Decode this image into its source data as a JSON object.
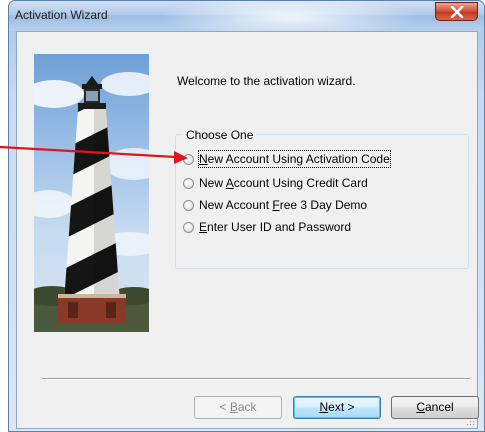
{
  "window": {
    "title": "Activation Wizard"
  },
  "main": {
    "welcome_text": "Welcome to the activation wizard.",
    "group_label": "Choose One",
    "options": [
      {
        "label": "New Account Using Activation Code",
        "mnemonic": "N",
        "selected": false,
        "focused": true
      },
      {
        "label": "New Account Using Credit Card",
        "mnemonic": "A",
        "selected": false,
        "focused": false
      },
      {
        "label": "New Account Free 3 Day Demo",
        "mnemonic": "F",
        "selected": false,
        "focused": false
      },
      {
        "label": "Enter User ID and Password",
        "mnemonic": "E",
        "selected": false,
        "focused": false
      }
    ]
  },
  "buttons": {
    "back_label": "< Back",
    "next_label": "Next >",
    "cancel_label": "Cancel"
  },
  "annotation": {
    "arrow_color": "#e0151d"
  }
}
